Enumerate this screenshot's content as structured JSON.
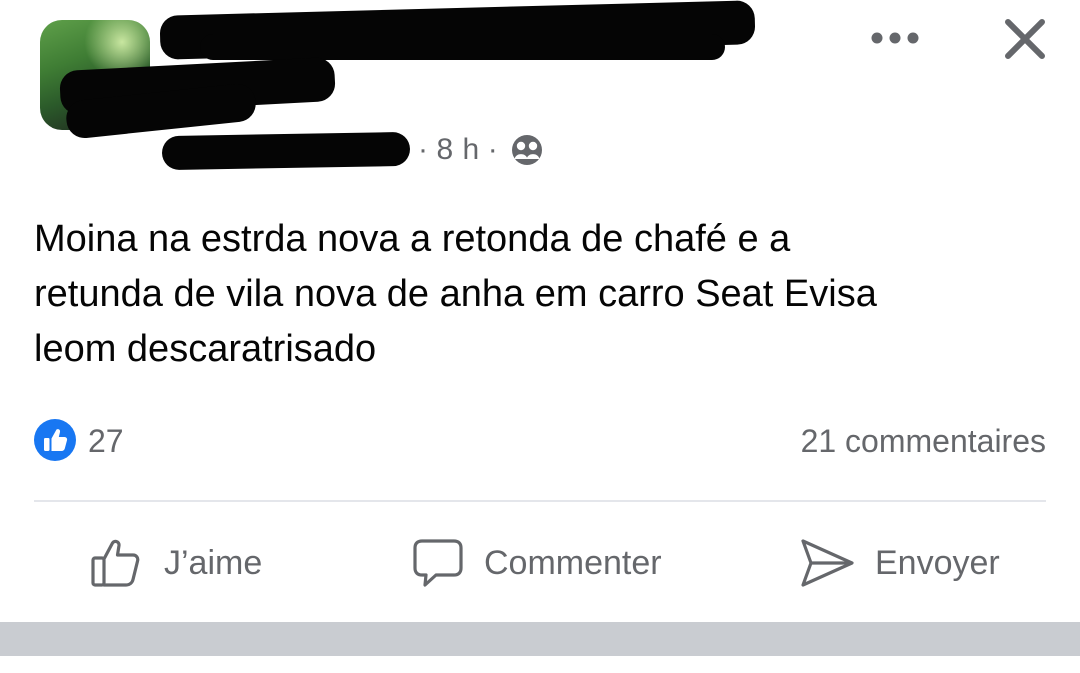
{
  "post": {
    "meta": {
      "time": "8 h",
      "separator": "·",
      "audience_icon": "friends-icon"
    },
    "text_lines": [
      "Moina na estrda nova a retonda de chafé e a",
      "retunda de vila nova de anha em carro Seat Evisa",
      "leom descaratrisado"
    ],
    "reactions": {
      "icon": "thumbs-up-badge-icon",
      "count": "27"
    },
    "comments_count": "21 commentaires",
    "actions": {
      "like_label": "J’aime",
      "comment_label": "Commenter",
      "send_label": "Envoyer"
    },
    "header_icons": {
      "more": "more-options-icon",
      "close": "close-icon"
    }
  },
  "colors": {
    "text": "#050505",
    "secondary": "#65676b",
    "like_blue": "#1877f2",
    "divider": "#e4e6eb",
    "footer": "#c9ccd1"
  }
}
